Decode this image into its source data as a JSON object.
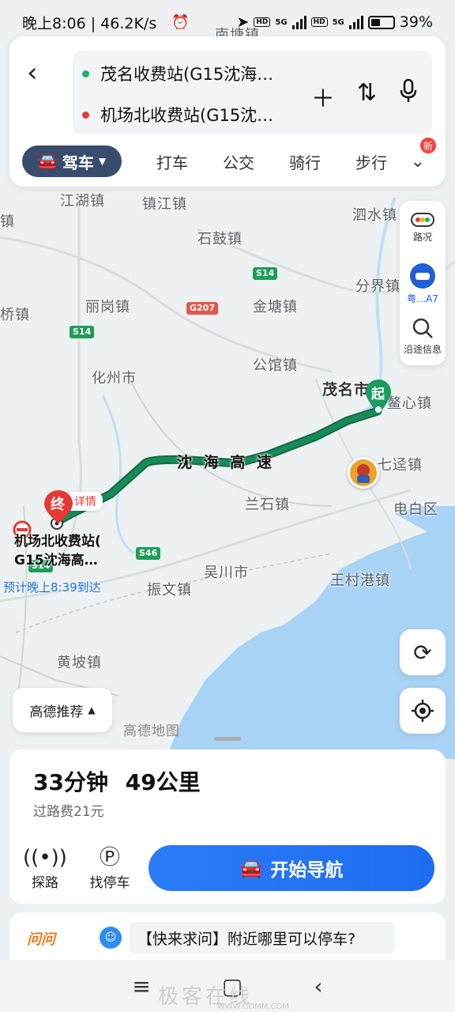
{
  "status": {
    "time_speed": "晚上8:06 | 46.2K/s",
    "battery": "39%",
    "hd1": "HD",
    "hd2": "HD",
    "net1": "5G",
    "net2": "5G"
  },
  "route": {
    "origin": "茂名收费站(G15沈海…",
    "destination": "机场北收费站(G15沈…",
    "origin_color": "#1bb36b",
    "destination_color": "#e53935"
  },
  "modes": {
    "active": "驾车",
    "items": [
      "打车",
      "公交",
      "骑行",
      "步行"
    ],
    "new_badge": "新"
  },
  "side_controls": {
    "traffic": "路况",
    "plate": "粤…A7",
    "along": "沿途信息"
  },
  "map": {
    "towns": [
      "南塘镇",
      "江湖镇",
      "镇江镇",
      "泗水镇",
      "石鼓镇",
      "丽岗镇",
      "分界镇",
      "桥镇",
      "金塘镇",
      "公馆镇",
      "化州市",
      "茂名市",
      "鳌心镇",
      "七迳镇",
      "兰石镇",
      "电白区",
      "吴川市",
      "振文镇",
      "王村港镇",
      "黄坡镇",
      "镇"
    ],
    "road_name": "沈 海 高 速",
    "shields": [
      "S14",
      "G207",
      "S14",
      "S46",
      "S14"
    ],
    "start_label": "起",
    "end_label": "终",
    "detail": "详情",
    "end_name_line1": "机场北收费站(",
    "end_name_line2": "G15沈海高…",
    "eta": "预计晚上8:39到达",
    "watermark": "高德地图",
    "route_color": "#1a8a5a"
  },
  "recommend": "高德推荐",
  "summary": {
    "duration": "33分钟",
    "distance": "49公里",
    "toll": "过路费21元"
  },
  "actions": {
    "explore": "探路",
    "parking": "找停车",
    "navigate": "开始导航"
  },
  "ask": {
    "logo": "问问",
    "text": "【快来求问】附近哪里可以停车?"
  },
  "watermark_bottom": "极客在线",
  "watermark_url": "WWW.GDMM.COM"
}
